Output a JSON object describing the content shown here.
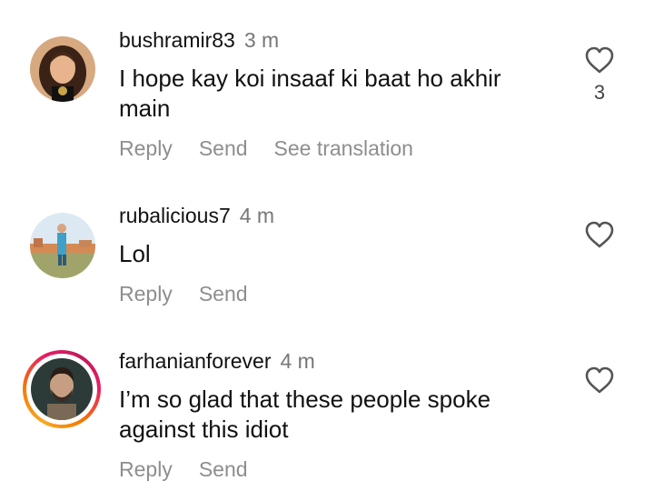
{
  "comments": [
    {
      "username": "bushramir83",
      "time": "3 m",
      "text": "I hope kay koi insaaf ki baat ho akhir main",
      "actions": [
        "Reply",
        "Send",
        "See translation"
      ],
      "likes": "3"
    },
    {
      "username": "rubalicious7",
      "time": "4 m",
      "text": "Lol",
      "actions": [
        "Reply",
        "Send"
      ]
    },
    {
      "username": "farhanianforever",
      "time": "4 m",
      "text": "I’m so glad that these people spoke against this idiot",
      "actions": [
        "Reply",
        "Send"
      ]
    }
  ],
  "icons": {
    "like": "heart-outline-icon"
  },
  "colors": {
    "text": "#111111",
    "secondary": "#8e8e8e",
    "story_ring": "#e91e63"
  }
}
